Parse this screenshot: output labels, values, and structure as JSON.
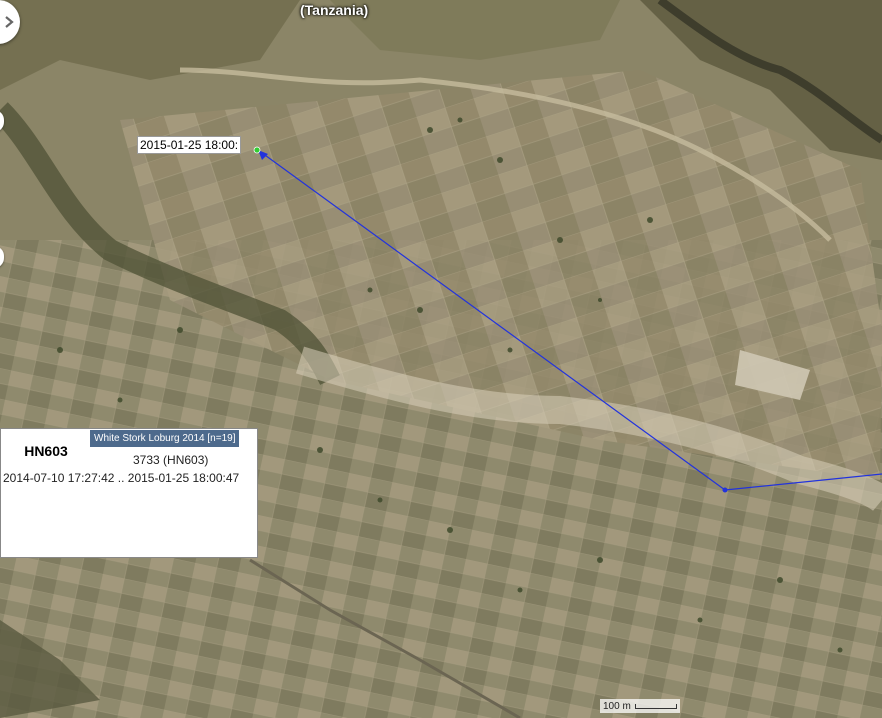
{
  "map": {
    "region_label": "(Tanzania)",
    "scale_label": "100 m"
  },
  "track": {
    "color": "#2233dd",
    "start_marker_color": "#33cc33",
    "label": "2015-01-25 18:00:"
  },
  "info_panel": {
    "title": "HN603",
    "study": "White Stork Loburg 2014 [n=19]",
    "individual": "3733 (HN603)",
    "date_range": "2014-07-10 17:27:42 .. 2015-01-25 18:00:47",
    "badge_color": "#4d6a8c"
  },
  "controls": {
    "toggle_icon": "chevron-right-icon"
  }
}
